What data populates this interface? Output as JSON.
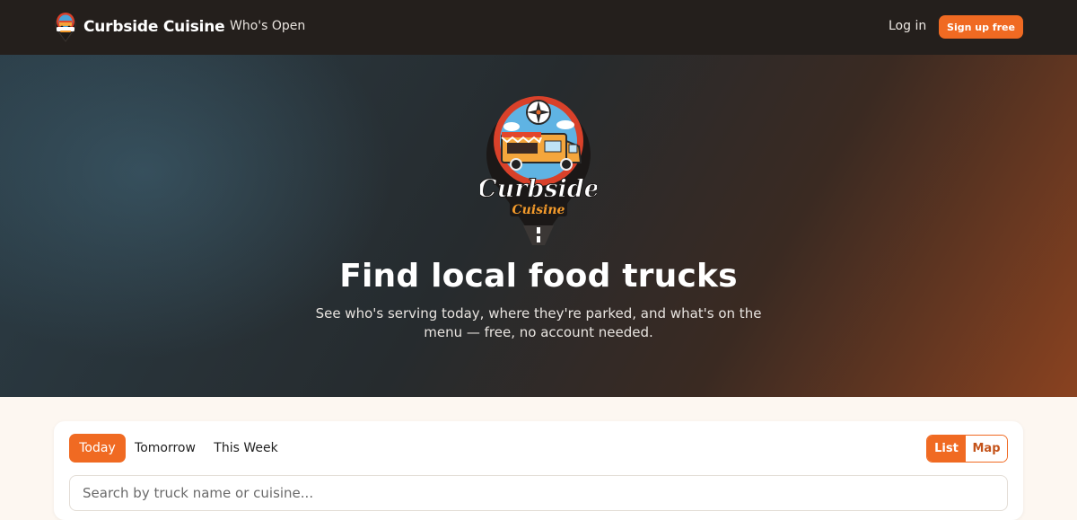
{
  "nav": {
    "brand_name": "Curbside Cuisine",
    "link_whos_open": "Who's Open",
    "login_label": "Log in",
    "signup_label": "Sign up free"
  },
  "hero": {
    "logo_word_1": "Curbside",
    "logo_word_2": "Cuisine",
    "title": "Find local food trucks",
    "subtitle": "See who's serving today, where they're parked, and what's on the menu — free, no account needed."
  },
  "filters": {
    "tabs": [
      {
        "label": "Today",
        "active": true
      },
      {
        "label": "Tomorrow",
        "active": false
      },
      {
        "label": "This Week",
        "active": false
      }
    ],
    "view_toggle": [
      {
        "label": "List",
        "active": true
      },
      {
        "label": "Map",
        "active": false
      }
    ],
    "search_placeholder": "Search by truck name or cuisine..."
  },
  "colors": {
    "accent": "#f06a22",
    "nav_bg": "#241f1c",
    "page_bg": "#fdf7f1"
  }
}
